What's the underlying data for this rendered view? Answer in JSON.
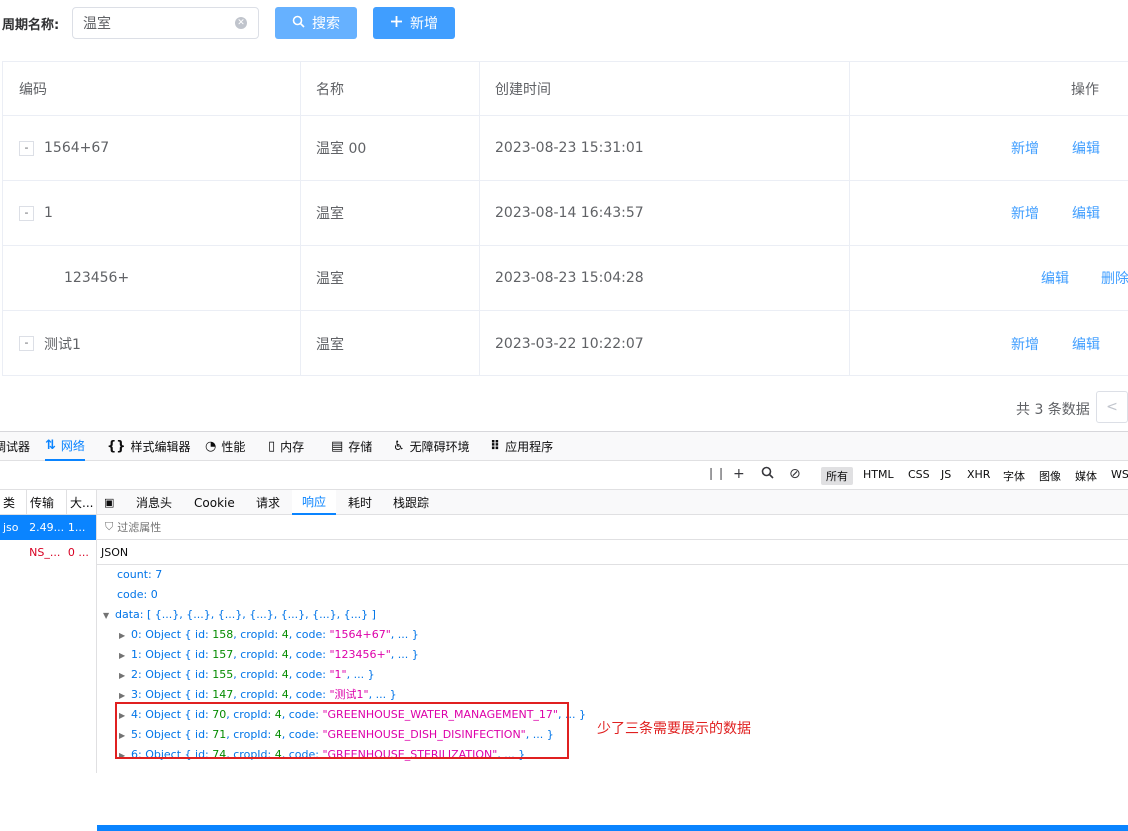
{
  "search": {
    "label": "周期名称:",
    "value": "温室",
    "search_button": "搜索",
    "add_button": "新增"
  },
  "table": {
    "headers": [
      "编码",
      "名称",
      "创建时间",
      "操作"
    ],
    "rows": [
      {
        "code": "1564+67",
        "name": "温室 00",
        "created": "2023-08-23 15:31:01",
        "actions": [
          "新增",
          "编辑"
        ],
        "expander": "-"
      },
      {
        "code": "1",
        "name": "温室",
        "created": "2023-08-14 16:43:57",
        "actions": [
          "新增",
          "编辑"
        ],
        "expander": "-"
      },
      {
        "code": "123456+",
        "name": "温室",
        "created": "2023-08-23 15:04:28",
        "actions": [
          "编辑",
          "删除"
        ],
        "expander": ""
      },
      {
        "code": "测试1",
        "name": "温室",
        "created": "2023-03-22 10:22:07",
        "actions": [
          "新增",
          "编辑"
        ],
        "expander": "-"
      }
    ]
  },
  "pagination": {
    "total": "共 3 条数据",
    "prev": "<"
  },
  "devtools": {
    "tabs": [
      {
        "icon": "",
        "label": "调试器"
      },
      {
        "icon": "⇅",
        "label": "网络"
      },
      {
        "icon": "{}",
        "label": "样式编辑器"
      },
      {
        "icon": "◔",
        "label": "性能"
      },
      {
        "icon": "▯",
        "label": "内存"
      },
      {
        "icon": "▤",
        "label": "存储"
      },
      {
        "icon": "♿",
        "label": "无障碍环境"
      },
      {
        "icon": "⠿",
        "label": "应用程序"
      }
    ],
    "filters": [
      "所有",
      "HTML",
      "CSS",
      "JS",
      "XHR",
      "字体",
      "图像",
      "媒体",
      "WS"
    ],
    "list_headers": [
      "类",
      "传输",
      "大..."
    ],
    "list_rows": [
      {
        "type": "jso",
        "transfer": "2.49...",
        "size": "1..."
      },
      {
        "type": "",
        "transfer": "NS_...",
        "size": "0 ..."
      }
    ],
    "sub_tabs": [
      "消息头",
      "Cookie",
      "请求",
      "响应",
      "耗时",
      "栈跟踪"
    ],
    "filter_placeholder": "过滤属性",
    "json_label": "JSON",
    "tree": {
      "count": "count: 7",
      "code": "code: 0",
      "data": "data: [ {...}, {...}, {...}, {...}, {...}, {...}, {...} ]",
      "items": [
        {
          "idx": "0: Object { id: ",
          "id": "158",
          "mid": ", cropId: ",
          "crop": "4",
          "mid2": ", code: ",
          "code": "\"1564+67\"",
          "tail": ", ... }"
        },
        {
          "idx": "1: Object { id: ",
          "id": "157",
          "mid": ", cropId: ",
          "crop": "4",
          "mid2": ", code: ",
          "code": "\"123456+\"",
          "tail": ", ... }"
        },
        {
          "idx": "2: Object { id: ",
          "id": "155",
          "mid": ", cropId: ",
          "crop": "4",
          "mid2": ", code: ",
          "code": "\"1\"",
          "tail": ", ... }"
        },
        {
          "idx": "3: Object { id: ",
          "id": "147",
          "mid": ", cropId: ",
          "crop": "4",
          "mid2": ", code: ",
          "code": "\"测试1\"",
          "tail": ", ... }"
        },
        {
          "idx": "4: Object { id: ",
          "id": "70",
          "mid": ", cropId: ",
          "crop": "4",
          "mid2": ", code: ",
          "code": "\"GREENHOUSE_WATER_MANAGEMENT_17\"",
          "tail": ", ... }"
        },
        {
          "idx": "5: Object { id: ",
          "id": "71",
          "mid": ", cropId: ",
          "crop": "4",
          "mid2": ", code: ",
          "code": "\"GREENHOUSE_DISH_DISINFECTION\"",
          "tail": ", ... }"
        },
        {
          "idx": "6: Object { id: ",
          "id": "74",
          "mid": ", cropId: ",
          "crop": "4",
          "mid2": ", code: ",
          "code": "\"GREENHOUSE_STERILIZATION\"",
          "tail": ", ... }"
        }
      ]
    }
  },
  "annotation": "少了三条需要展示的数据",
  "colors": {
    "primary": "#409eff",
    "primary_light": "#66b1ff",
    "annotation_red": "#e02020",
    "devtools_blue": "#0a84ff"
  }
}
